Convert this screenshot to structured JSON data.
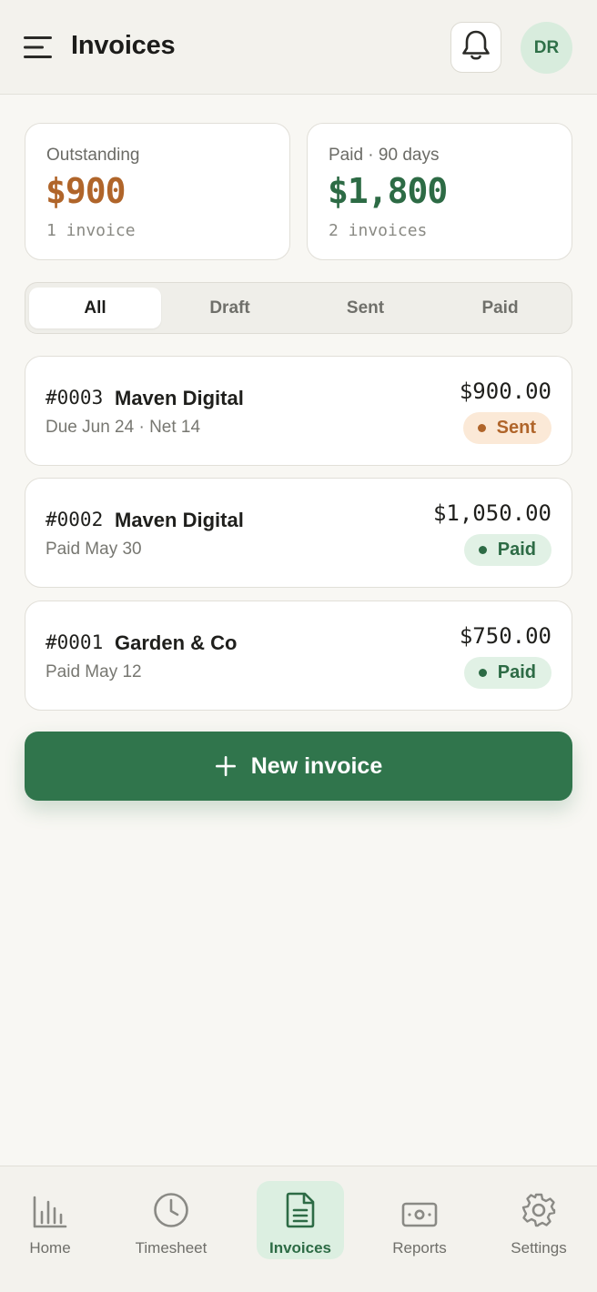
{
  "header": {
    "title": "Invoices",
    "avatar_initials": "DR"
  },
  "summary": {
    "outstanding": {
      "label": "Outstanding",
      "amount": "$900",
      "sub": "1 invoice",
      "color": "#b0652a"
    },
    "paid": {
      "label": "Paid · 90 days",
      "amount": "$1,800",
      "sub": "2 invoices",
      "color": "#2d6b45"
    }
  },
  "tabs": [
    {
      "label": "All",
      "active": true
    },
    {
      "label": "Draft",
      "active": false
    },
    {
      "label": "Sent",
      "active": false
    },
    {
      "label": "Paid",
      "active": false
    }
  ],
  "invoices": [
    {
      "number": "#0003",
      "client": "Maven Digital",
      "meta": "Due Jun 24 · Net 14",
      "amount": "$900.00",
      "status": "Sent"
    },
    {
      "number": "#0002",
      "client": "Maven Digital",
      "meta": "Paid May 30",
      "amount": "$1,050.00",
      "status": "Paid"
    },
    {
      "number": "#0001",
      "client": "Garden & Co",
      "meta": "Paid May 12",
      "amount": "$750.00",
      "status": "Paid"
    }
  ],
  "new_invoice": {
    "label": "New invoice",
    "icon": "plus-icon"
  },
  "nav": [
    {
      "label": "Home",
      "icon": "bar-chart-icon",
      "active": false
    },
    {
      "label": "Timesheet",
      "icon": "clock-icon",
      "active": false
    },
    {
      "label": "Invoices",
      "icon": "document-icon",
      "active": true
    },
    {
      "label": "Reports",
      "icon": "banknote-icon",
      "active": false
    },
    {
      "label": "Settings",
      "icon": "gear-icon",
      "active": false
    }
  ],
  "colors": {
    "accent": "#30754c",
    "sent": "#b0652a",
    "paid": "#2d6b45"
  }
}
